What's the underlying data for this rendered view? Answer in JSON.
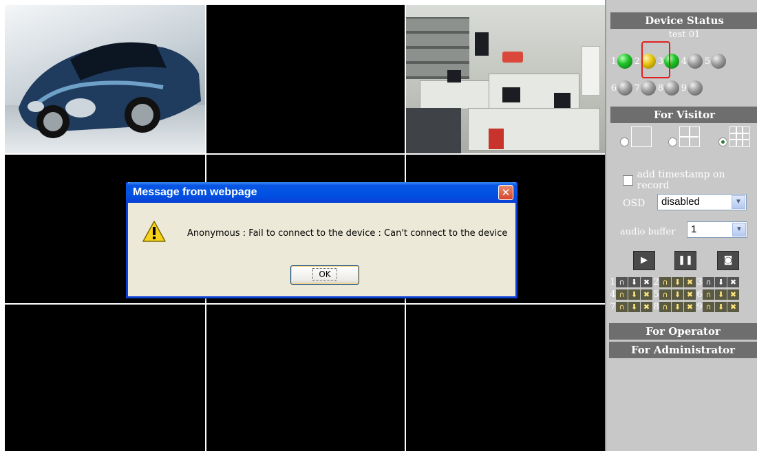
{
  "dialog": {
    "title": "Message from webpage",
    "message": "Anonymous : Fail to connect to the device : Can't connect to the device",
    "ok_label": "OK",
    "close_glyph": "✕",
    "icon": "warning-icon"
  },
  "panel": {
    "device_status": {
      "header": "Device Status",
      "device_name": "test 01",
      "channels": [
        {
          "num": "1",
          "status": "green"
        },
        {
          "num": "2",
          "status": "yellow"
        },
        {
          "num": "3",
          "status": "green"
        },
        {
          "num": "4",
          "status": "grey"
        },
        {
          "num": "5",
          "status": "grey"
        },
        {
          "num": "6",
          "status": "grey"
        },
        {
          "num": "7",
          "status": "grey"
        },
        {
          "num": "8",
          "status": "grey"
        },
        {
          "num": "9",
          "status": "grey"
        }
      ]
    },
    "visitor": {
      "header": "For Visitor",
      "layouts": [
        "single",
        "quad",
        "nine"
      ],
      "selected_layout": "nine",
      "timestamp_label": "add timestamp on record",
      "osd_label": "OSD",
      "osd_value": "disabled",
      "audio_label": "audio buffer",
      "audio_value": "1",
      "ptz_channels": [
        "1",
        "2",
        "3",
        "4",
        "5",
        "6",
        "7",
        "8",
        "9"
      ]
    },
    "operator_header": "For Operator",
    "admin_header": "For Administrator"
  },
  "colors": {
    "panel_bg": "#c8c8c8",
    "section_header": "#6e6e6e",
    "dialog_title": "#0a56e5",
    "selection_highlight": "#e02020"
  }
}
